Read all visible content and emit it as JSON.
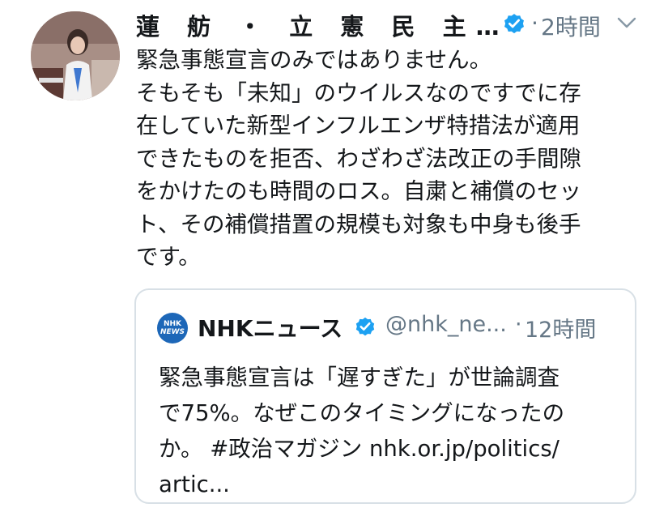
{
  "tweet": {
    "author": {
      "display_name": "蓮 舫 ・ 立 憲 民 主…",
      "verified_icon": "verified-badge-icon",
      "avatar_icon": "profile-photo"
    },
    "separator": "·",
    "timestamp": "2時間",
    "menu_icon": "chevron-down-icon",
    "body_lines": [
      "緊急事態宣言のみではありません。",
      "そもそも「未知」のウイルスなのですでに存",
      "在していた新型インフルエンザ特措法が適用",
      "できたものを拒否、わざわざ法改正の手間隙",
      "をかけたのも時間のロス。自粛と補償のセッ",
      "ト、その補償措置の規模も対象も中身も後手",
      "です。"
    ]
  },
  "quoted_tweet": {
    "logo_lines": [
      "NHK",
      "NEWS"
    ],
    "display_name": "NHKニュース",
    "handle": "@nhk_ne...",
    "separator": "·",
    "timestamp": "12時間",
    "body_lines": [
      "緊急事態宣言は「遅すぎた」が世論調査",
      "で75%。なぜこのタイミングになったの",
      "か。 #政治マガジン nhk.or.jp/politics/",
      "artic..."
    ]
  },
  "colors": {
    "text": "#14171a",
    "secondary": "#657786",
    "verified": "#1da1f2",
    "border": "#d8e0e6",
    "nhk_blue": "#1d67b8"
  }
}
